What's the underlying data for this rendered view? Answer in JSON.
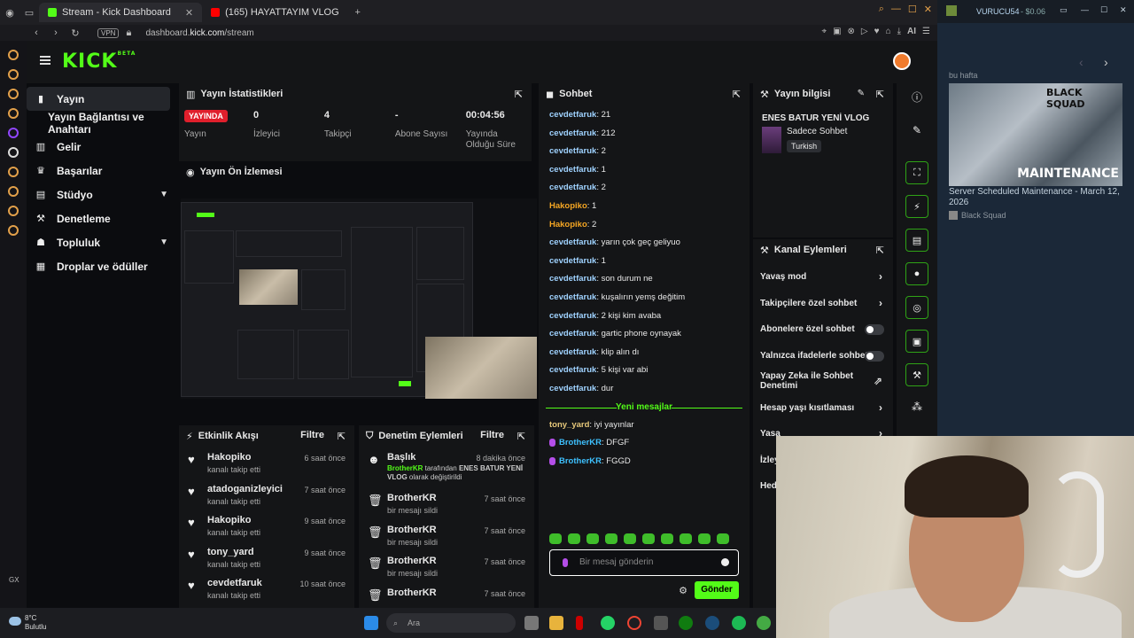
{
  "browser": {
    "tabs": [
      {
        "label": "Stream - Kick Dashboard",
        "color": "#53fc18"
      },
      {
        "label": "(165) HAYATTAYIM VLOG",
        "color": "#ff0000"
      }
    ],
    "url_host": "dashboard.",
    "url_bold": "kick.com",
    "url_path": "/stream",
    "vpn": "VPN",
    "ai": "AI"
  },
  "nav": {
    "items": [
      {
        "label": "Yayın",
        "icon": "video-icon"
      },
      {
        "label": "Yayın Bağlantısı ve Anahtarı",
        "icon": ""
      },
      {
        "label": "Gelir",
        "icon": "chart-icon"
      },
      {
        "label": "Başarılar",
        "icon": "trophy-icon"
      },
      {
        "label": "Stüdyo",
        "icon": "grid-icon"
      },
      {
        "label": "Denetleme",
        "icon": "gavel-icon"
      },
      {
        "label": "Topluluk",
        "icon": "users-icon"
      },
      {
        "label": "Droplar ve ödüller",
        "icon": "gift-icon"
      }
    ]
  },
  "stats": {
    "title": "Yayın İstatistikleri",
    "live": "YAYINDA",
    "items": [
      {
        "value": "",
        "label": "Yayın"
      },
      {
        "value": "0",
        "label": "İzleyici"
      },
      {
        "value": "4",
        "label": "Takipçi"
      },
      {
        "value": "-",
        "label": "Abone Sayısı"
      },
      {
        "value": "00:04:56",
        "label": "Yayında Olduğu Süre"
      }
    ]
  },
  "preview": {
    "title": "Yayın Ön İzlemesi"
  },
  "activity": {
    "title": "Etkinlik Akışı",
    "filter": "Filtre",
    "items": [
      {
        "user": "Hakopiko",
        "action": "kanalı takip etti",
        "time": "6 saat önce"
      },
      {
        "user": "atadoganizleyici",
        "action": "kanalı takip etti",
        "time": "7 saat önce"
      },
      {
        "user": "Hakopiko",
        "action": "kanalı takip etti",
        "time": "9 saat önce"
      },
      {
        "user": "tony_yard",
        "action": "kanalı takip etti",
        "time": "9 saat önce"
      },
      {
        "user": "cevdetfaruk",
        "action": "kanalı takip etti",
        "time": "10 saat önce"
      }
    ]
  },
  "moderation": {
    "title": "Denetim Eylemleri",
    "filter": "Filtre",
    "first": {
      "user": "Başlık",
      "time": "8 dakika önce",
      "by": "BrotherKR",
      "mid": " tarafından ",
      "bold": "ENES BATUR YENİ VLOG",
      "end": " olarak değiştirildi"
    },
    "items": [
      {
        "user": "BrotherKR",
        "action": "bir mesajı sildi",
        "time": "7 saat önce"
      },
      {
        "user": "BrotherKR",
        "action": "bir mesajı sildi",
        "time": "7 saat önce"
      },
      {
        "user": "BrotherKR",
        "action": "bir mesajı sildi",
        "time": "7 saat önce"
      },
      {
        "user": "BrotherKR",
        "action": "",
        "time": "7 saat önce"
      }
    ]
  },
  "chat": {
    "title": "Sohbet",
    "messages": [
      {
        "user": "cevdetfaruk",
        "text": ": 21",
        "cls": "u1"
      },
      {
        "user": "cevdetfaruk",
        "text": ": 212",
        "cls": "u1"
      },
      {
        "user": "cevdetfaruk",
        "text": ": 2",
        "cls": "u1"
      },
      {
        "user": "cevdetfaruk",
        "text": ": 1",
        "cls": "u1"
      },
      {
        "user": "cevdetfaruk",
        "text": ": 2",
        "cls": "u1"
      },
      {
        "user": "Hakopiko",
        "text": ": 1",
        "cls": "u2"
      },
      {
        "user": "Hakopiko",
        "text": ": 2",
        "cls": "u2"
      },
      {
        "user": "cevdetfaruk",
        "text": ": yarın çok geç geliyuo",
        "cls": "u1"
      },
      {
        "user": "cevdetfaruk",
        "text": ": 1",
        "cls": "u1"
      },
      {
        "user": "cevdetfaruk",
        "text": ": son durum ne",
        "cls": "u1"
      },
      {
        "user": "cevdetfaruk",
        "text": ": kuşalırın yemş değitim",
        "cls": "u1"
      },
      {
        "user": "cevdetfaruk",
        "text": ": 2 kişi kim avaba",
        "cls": "u1"
      },
      {
        "user": "cevdetfaruk",
        "text": ": gartic phone oynayak",
        "cls": "u1"
      },
      {
        "user": "cevdetfaruk",
        "text": ": klip alın dı",
        "cls": "u1"
      },
      {
        "user": "cevdetfaruk",
        "text": ": 5 kişi var abi",
        "cls": "u1"
      },
      {
        "user": "cevdetfaruk",
        "text": ": dur",
        "cls": "u1"
      }
    ],
    "new_label": "Yeni mesajlar",
    "new_messages": [
      {
        "user": "tony_yard",
        "text": ": iyi yayınlar",
        "cls": "u3",
        "badge": false
      },
      {
        "user": "BrotherKR",
        "text": ": DFGF",
        "cls": "u4",
        "badge": true
      },
      {
        "user": "BrotherKR",
        "text": ": FGGD",
        "cls": "u4",
        "badge": true
      }
    ],
    "placeholder": "Bir mesaj gönderin",
    "send": "Gönder"
  },
  "info": {
    "title": "Yayın bilgisi",
    "stream_title": "ENES BATUR YENİ VLOG",
    "category": "Sadece Sohbet",
    "tag": "Turkish"
  },
  "actions": {
    "title": "Kanal Eylemleri",
    "items": [
      {
        "label": "Yavaş mod",
        "kind": "arrow"
      },
      {
        "label": "Takipçilere özel sohbet",
        "kind": "arrow"
      },
      {
        "label": "Abonelere özel sohbet",
        "kind": "toggle"
      },
      {
        "label": "Yalnızca ifadelerle sohbet",
        "kind": "toggle"
      },
      {
        "label": "Yapay Zeka ile Sohbet Denetimi",
        "kind": "link"
      },
      {
        "label": "Hesap yaşı kısıtlaması",
        "kind": "arrow"
      },
      {
        "label": "Yasa",
        "kind": "arrow"
      },
      {
        "label": "İzley",
        "kind": "none"
      },
      {
        "label": "Hed",
        "kind": "none"
      }
    ]
  },
  "steam": {
    "user": "VURUCU54",
    "balance": "- $0.06",
    "week": "bu hafta",
    "news_title": "Server Scheduled Maintenance - March 12, 2026",
    "game": "Black Squad",
    "banner_brand": "BLACK SQUAD",
    "banner_text": "MAINTENANCE"
  },
  "taskbar": {
    "temp": "8°C",
    "weather": "Bulutlu",
    "search": "Ara",
    "gx": "GX"
  }
}
